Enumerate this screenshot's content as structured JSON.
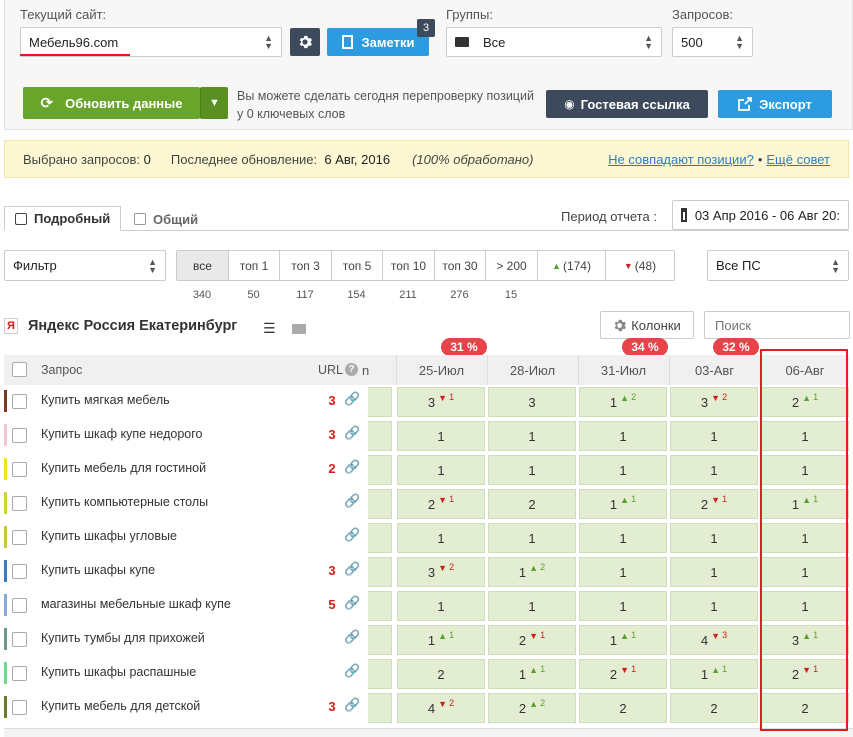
{
  "top": {
    "site_label": "Текущий сайт:",
    "site_value": "Мебель96.com",
    "notes_label": "Заметки",
    "notes_badge": "3",
    "groups_label": "Группы:",
    "groups_value": "Все",
    "queries_label": "Запросов:",
    "queries_value": "500",
    "update_label": "Обновить данные",
    "recheck_text_1": "Вы можете сделать сегодня перепроверку позиций",
    "recheck_text_2": "у 0 ключевых слов",
    "guest_label": "Гостевая ссылка",
    "export_label": "Экспорт"
  },
  "info": {
    "selected_label": "Выбрано запросов:",
    "selected_value": "0",
    "last_update_label": "Последнее обновление:",
    "last_update_value": "6 Авг, 2016",
    "processed": "(100% обработано)",
    "mismatch_link": "Не совпадают позиции?",
    "separator": "•",
    "tip_link": "Ещё совет"
  },
  "tabs": [
    {
      "label": "Подробный"
    },
    {
      "label": "Общий"
    }
  ],
  "period": {
    "label": "Период отчета :",
    "value": "03 Апр 2016 - 06 Авг 20:"
  },
  "filter": {
    "select_value": "Фильтр",
    "buttons": [
      {
        "label": "все",
        "count": "340"
      },
      {
        "label": "топ 1",
        "count": "50"
      },
      {
        "label": "топ 3",
        "count": "117"
      },
      {
        "label": "топ 5",
        "count": "154"
      },
      {
        "label": "топ 10",
        "count": "211"
      },
      {
        "label": "топ 30",
        "count": "276"
      },
      {
        "label": "> 200",
        "count": "15"
      },
      {
        "label": "(174)",
        "count": ""
      },
      {
        "label": "(48)",
        "count": ""
      }
    ],
    "ps_value": "Все ПС"
  },
  "section": {
    "ya_letter": "Я",
    "title": "Яндекс Россия Екатеринбург",
    "columns_label": "Колонки",
    "search_placeholder": "Поиск"
  },
  "table": {
    "col_query": "Запрос",
    "col_url": "URL",
    "help": "?",
    "cut_col": "n",
    "dates": [
      {
        "label": "25-Июл",
        "pct": "31 %"
      },
      {
        "label": "28-Июл",
        "pct": ""
      },
      {
        "label": "31-Июл",
        "pct": "34 %"
      },
      {
        "label": "03-Авг",
        "pct": "32 %"
      },
      {
        "label": "06-Авг",
        "pct": ""
      }
    ],
    "rows": [
      {
        "color": "#7a3b1c",
        "query": "Купить мягкая мебель",
        "url": "3",
        "cells": [
          {
            "v": "3",
            "d": "-1"
          },
          {
            "v": "3",
            "d": ""
          },
          {
            "v": "1",
            "d": "+2"
          },
          {
            "v": "3",
            "d": "-2"
          },
          {
            "v": "2",
            "d": "+1"
          }
        ]
      },
      {
        "color": "#f2c6d9",
        "query": "Купить шкаф купе недорого",
        "url": "3",
        "cells": [
          {
            "v": "1",
            "d": ""
          },
          {
            "v": "1",
            "d": ""
          },
          {
            "v": "1",
            "d": ""
          },
          {
            "v": "1",
            "d": ""
          },
          {
            "v": "1",
            "d": ""
          }
        ]
      },
      {
        "color": "#f2e21f",
        "query": "Купить мебель для гостиной",
        "url": "2",
        "cells": [
          {
            "v": "1",
            "d": ""
          },
          {
            "v": "1",
            "d": ""
          },
          {
            "v": "1",
            "d": ""
          },
          {
            "v": "1",
            "d": ""
          },
          {
            "v": "1",
            "d": ""
          }
        ]
      },
      {
        "color": "#c9d82a",
        "query": "Купить компьютерные столы",
        "url": "",
        "cells": [
          {
            "v": "2",
            "d": "-1"
          },
          {
            "v": "2",
            "d": ""
          },
          {
            "v": "1",
            "d": "+1"
          },
          {
            "v": "2",
            "d": "-1"
          },
          {
            "v": "1",
            "d": "+1"
          }
        ]
      },
      {
        "color": "#c6c83a",
        "query": "Купить шкафы угловые",
        "url": "",
        "cells": [
          {
            "v": "1",
            "d": ""
          },
          {
            "v": "1",
            "d": ""
          },
          {
            "v": "1",
            "d": ""
          },
          {
            "v": "1",
            "d": ""
          },
          {
            "v": "1",
            "d": ""
          }
        ]
      },
      {
        "color": "#3b7bbf",
        "query": "Купить шкафы купе",
        "url": "3",
        "cells": [
          {
            "v": "3",
            "d": "-2"
          },
          {
            "v": "1",
            "d": "+2"
          },
          {
            "v": "1",
            "d": ""
          },
          {
            "v": "1",
            "d": ""
          },
          {
            "v": "1",
            "d": ""
          }
        ]
      },
      {
        "color": "#8aa9d9",
        "query": "магазины мебельные шкаф купе",
        "url": "5",
        "cells": [
          {
            "v": "1",
            "d": ""
          },
          {
            "v": "1",
            "d": ""
          },
          {
            "v": "1",
            "d": ""
          },
          {
            "v": "1",
            "d": ""
          },
          {
            "v": "1",
            "d": ""
          }
        ]
      },
      {
        "color": "#6a9a8a",
        "query": "Купить тумбы для прихожей",
        "url": "",
        "cells": [
          {
            "v": "1",
            "d": "+1"
          },
          {
            "v": "2",
            "d": "-1"
          },
          {
            "v": "1",
            "d": "+1"
          },
          {
            "v": "4",
            "d": "-3"
          },
          {
            "v": "3",
            "d": "+1"
          }
        ]
      },
      {
        "color": "#6fd88a",
        "query": "Купить шкафы распашные",
        "url": "",
        "cells": [
          {
            "v": "2",
            "d": ""
          },
          {
            "v": "1",
            "d": "+1"
          },
          {
            "v": "2",
            "d": "-1"
          },
          {
            "v": "1",
            "d": "+1"
          },
          {
            "v": "2",
            "d": "-1"
          }
        ]
      },
      {
        "color": "#6a7a2a",
        "query": "Купить мебель для детской",
        "url": "3",
        "cells": [
          {
            "v": "4",
            "d": "-2"
          },
          {
            "v": "2",
            "d": "+2"
          },
          {
            "v": "2",
            "d": ""
          },
          {
            "v": "2",
            "d": ""
          },
          {
            "v": "2",
            "d": ""
          }
        ]
      }
    ]
  }
}
